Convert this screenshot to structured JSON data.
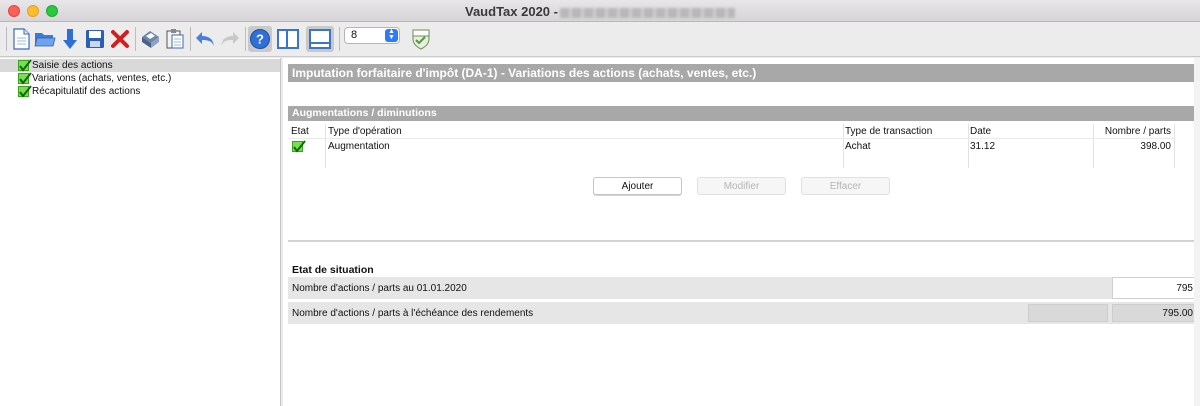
{
  "window": {
    "title": "VaudTax 2020 -"
  },
  "toolbar": {
    "zoom_value": "8",
    "icons": [
      "new-document-icon",
      "open-folder-icon",
      "download-arrow-icon",
      "save-icon",
      "delete-x-icon",
      "print-icon",
      "clipboard-icon",
      "undo-icon",
      "redo-icon",
      "help-icon",
      "panel-layout-icon",
      "panel-layout-bottom-icon",
      "vaud-shield-icon"
    ]
  },
  "sidebar": {
    "items": [
      {
        "label": "Saisie des actions",
        "checked": true,
        "selected": true
      },
      {
        "label": "Variations (achats, ventes, etc.)",
        "checked": true,
        "selected": false
      },
      {
        "label": "Récapitulatif des actions",
        "checked": true,
        "selected": false
      }
    ]
  },
  "main": {
    "header": "Imputation forfaitaire d'impôt (DA-1) - Variations des actions (achats, ventes, etc.)",
    "section": "Augmentations / diminutions",
    "table": {
      "columns": [
        "Etat",
        "Type d'opération",
        "Type de transaction",
        "Date",
        "Nombre / parts"
      ],
      "rows": [
        {
          "etat": "checked",
          "type_operation": "Augmentation",
          "type_transaction": "Achat",
          "date": "31.12",
          "nombre": "398.00"
        }
      ]
    },
    "buttons": {
      "add": "Ajouter",
      "modify": "Modifier",
      "delete": "Effacer"
    },
    "etat": {
      "title": "Etat de situation",
      "row1_label": "Nombre d'actions / parts au 01.01.2020",
      "row1_value": "795",
      "row2_label": "Nombre d'actions / parts à l'échéance des rendements",
      "row2_value": "795.00"
    }
  },
  "colors": {
    "header_bg": "#a8a8a8",
    "check_green": "#7bdc55",
    "accent_blue": "#2f7bf5"
  }
}
